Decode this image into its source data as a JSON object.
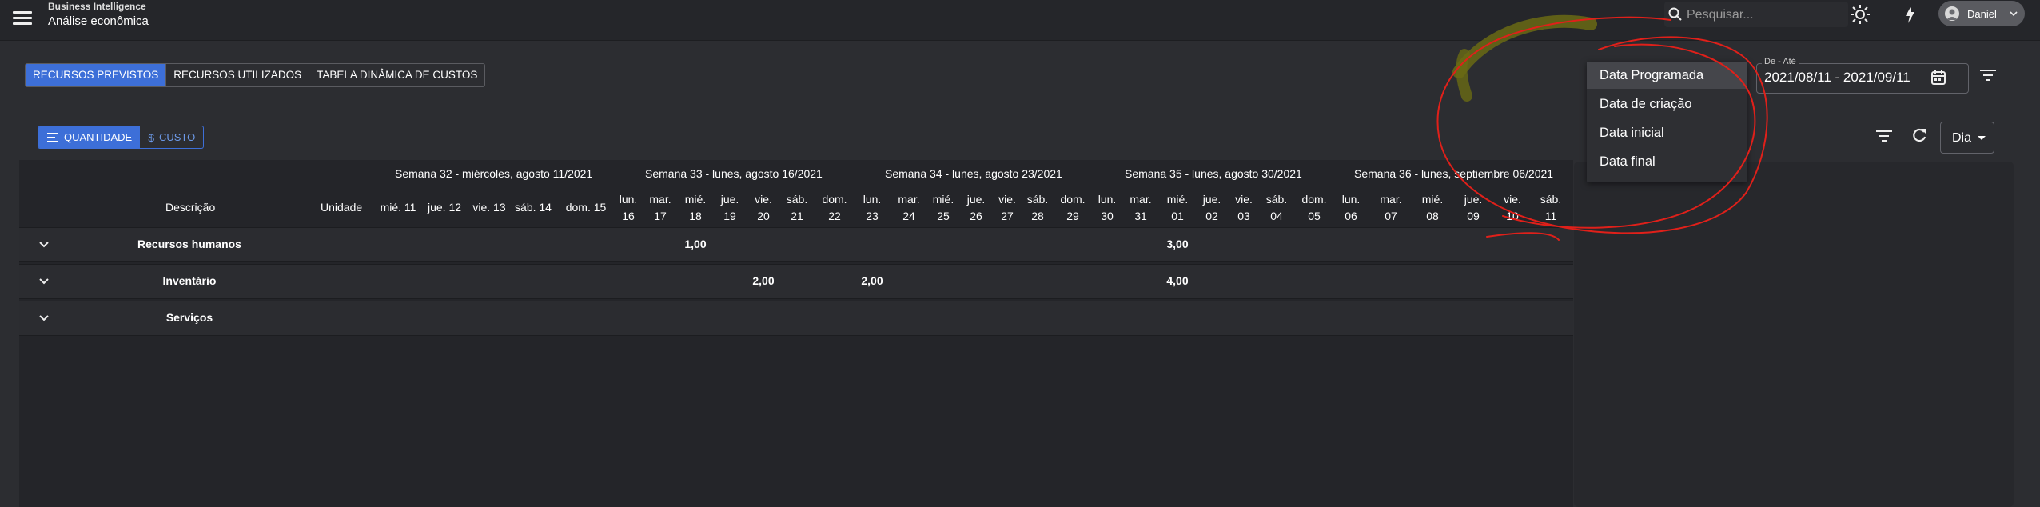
{
  "header": {
    "subtitle": "Business Intelligence",
    "title": "Análise econômica",
    "search_placeholder": "Pesquisar...",
    "user_name": "Daniel"
  },
  "tabs": [
    {
      "label": "RECURSOS PREVISTOS",
      "active": true
    },
    {
      "label": "RECURSOS UTILIZADOS",
      "active": false
    },
    {
      "label": "TABELA DINÂMICA DE CUSTOS",
      "active": false
    }
  ],
  "toggle": {
    "quantity": "QUANTIDADE",
    "cost": "CUSTO"
  },
  "date_range": {
    "label": "De - Até",
    "value": "2021/08/11 - 2021/09/11"
  },
  "granularity": "Dia",
  "date_type_menu": [
    "Data Programada",
    "Data de criação",
    "Data inicial",
    "Data final"
  ],
  "table": {
    "col_description": "Descrição",
    "col_unit": "Unidade",
    "weeks": [
      "Semana 32 - miércoles, agosto 11/2021",
      "Semana 33 - lunes, agosto 16/2021",
      "Semana 34 - lunes, agosto 23/2021",
      "Semana 35 - lunes, agosto 30/2021",
      "Semana 36 - lunes, septiembre 06/2021"
    ],
    "days": [
      {
        "l1": "mié. 11",
        "l2": ""
      },
      {
        "l1": "jue. 12",
        "l2": ""
      },
      {
        "l1": "vie. 13",
        "l2": ""
      },
      {
        "l1": "sáb. 14",
        "l2": ""
      },
      {
        "l1": "dom. 15",
        "l2": ""
      },
      {
        "l1": "lun.",
        "l2": "16"
      },
      {
        "l1": "mar.",
        "l2": "17"
      },
      {
        "l1": "mié.",
        "l2": "18"
      },
      {
        "l1": "jue.",
        "l2": "19"
      },
      {
        "l1": "vie.",
        "l2": "20"
      },
      {
        "l1": "sáb.",
        "l2": "21"
      },
      {
        "l1": "dom.",
        "l2": "22"
      },
      {
        "l1": "lun.",
        "l2": "23"
      },
      {
        "l1": "mar.",
        "l2": "24"
      },
      {
        "l1": "mié.",
        "l2": "25"
      },
      {
        "l1": "jue.",
        "l2": "26"
      },
      {
        "l1": "vie.",
        "l2": "27"
      },
      {
        "l1": "sáb.",
        "l2": "28"
      },
      {
        "l1": "dom.",
        "l2": "29"
      },
      {
        "l1": "lun.",
        "l2": "30"
      },
      {
        "l1": "mar.",
        "l2": "31"
      },
      {
        "l1": "mié.",
        "l2": "01"
      },
      {
        "l1": "jue.",
        "l2": "02"
      },
      {
        "l1": "vie.",
        "l2": "03"
      },
      {
        "l1": "sáb.",
        "l2": "04"
      },
      {
        "l1": "dom.",
        "l2": "05"
      },
      {
        "l1": "lun.",
        "l2": "06"
      },
      {
        "l1": "mar.",
        "l2": "07"
      },
      {
        "l1": "mié.",
        "l2": "08"
      },
      {
        "l1": "jue.",
        "l2": "09"
      },
      {
        "l1": "vie.",
        "l2": "10"
      },
      {
        "l1": "sáb.",
        "l2": "11"
      }
    ],
    "rows": [
      {
        "label": "Recursos humanos",
        "values": [
          {
            "day": 7,
            "value": "1,00"
          },
          {
            "day": 21,
            "value": "3,00"
          }
        ]
      },
      {
        "label": "Inventário",
        "values": [
          {
            "day": 9,
            "value": "2,00"
          },
          {
            "day": 12,
            "value": "2,00"
          },
          {
            "day": 21,
            "value": "4,00"
          }
        ]
      },
      {
        "label": "Serviços",
        "values": []
      }
    ]
  },
  "colors": {
    "accent": "#3d6fd8",
    "annotation": "#e0201a"
  }
}
